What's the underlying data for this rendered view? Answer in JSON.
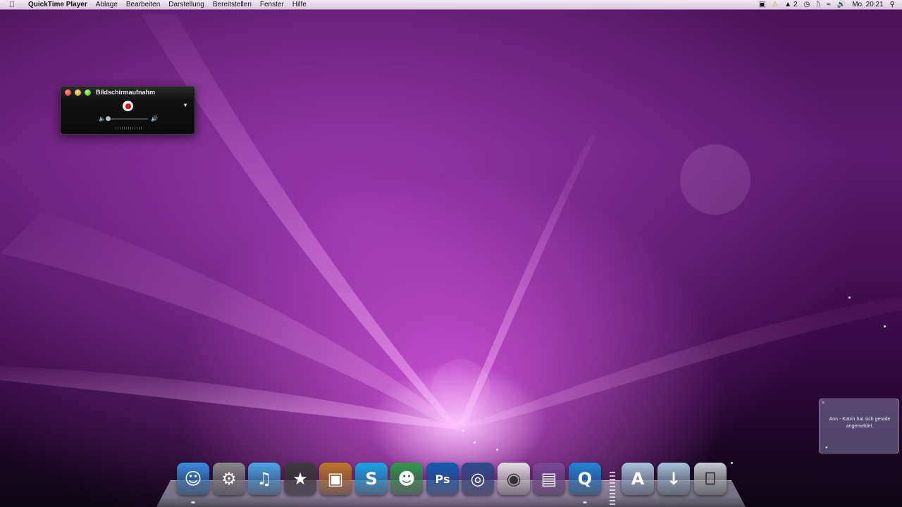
{
  "menubar": {
    "apple": "",
    "app_name": "QuickTime Player",
    "items": [
      "Ablage",
      "Bearbeiten",
      "Darstellung",
      "Bereitstellen",
      "Fenster",
      "Hilfe"
    ],
    "status": {
      "badge_count": "2",
      "clock": "Mo. 20:21"
    }
  },
  "qt_window": {
    "title": "Bildschirmaufnahm"
  },
  "notification": {
    "text": "Ann - Katrin hat sich gerade angemeldet."
  },
  "dock": {
    "items": [
      {
        "name": "finder",
        "icon": "finder-icon",
        "color": "#3a8de0"
      },
      {
        "name": "system-preferences",
        "icon": "gear-icon",
        "color": "#8a8a8a"
      },
      {
        "name": "itunes",
        "icon": "music-note-icon",
        "color": "#4aa8e8"
      },
      {
        "name": "imovie",
        "icon": "star-icon",
        "color": "#3a3a3a"
      },
      {
        "name": "iphoto",
        "icon": "photo-camera-icon",
        "color": "#c0782a"
      },
      {
        "name": "skype",
        "icon": "skype-icon",
        "color": "#19a6e8"
      },
      {
        "name": "messenger",
        "icon": "people-icon",
        "color": "#2e9a4a"
      },
      {
        "name": "photoshop",
        "icon": "ps-icon",
        "color": "#0a5ab0"
      },
      {
        "name": "dvd-player",
        "icon": "globe-icon",
        "color": "#2a4a8a"
      },
      {
        "name": "chrome",
        "icon": "chrome-icon",
        "color": "#e0e0e0"
      },
      {
        "name": "photo-booth",
        "icon": "film-icon",
        "color": "#7a4a9a"
      },
      {
        "name": "quicktime",
        "icon": "quicktime-icon",
        "color": "#1e88d8"
      },
      {
        "name": "applications-folder",
        "icon": "applications-folder-icon",
        "color": "#a8c4dc"
      },
      {
        "name": "downloads-folder",
        "icon": "downloads-folder-icon",
        "color": "#a8c4dc"
      },
      {
        "name": "trash",
        "icon": "trash-icon",
        "color": "#c8ccd4"
      }
    ],
    "glyphs": [
      "☺",
      "⚙",
      "♫",
      "★",
      "▣",
      "S",
      "☻",
      "Ps",
      "◎",
      "◉",
      "▤",
      "Q",
      "A",
      "↓",
      "⎕"
    ]
  }
}
